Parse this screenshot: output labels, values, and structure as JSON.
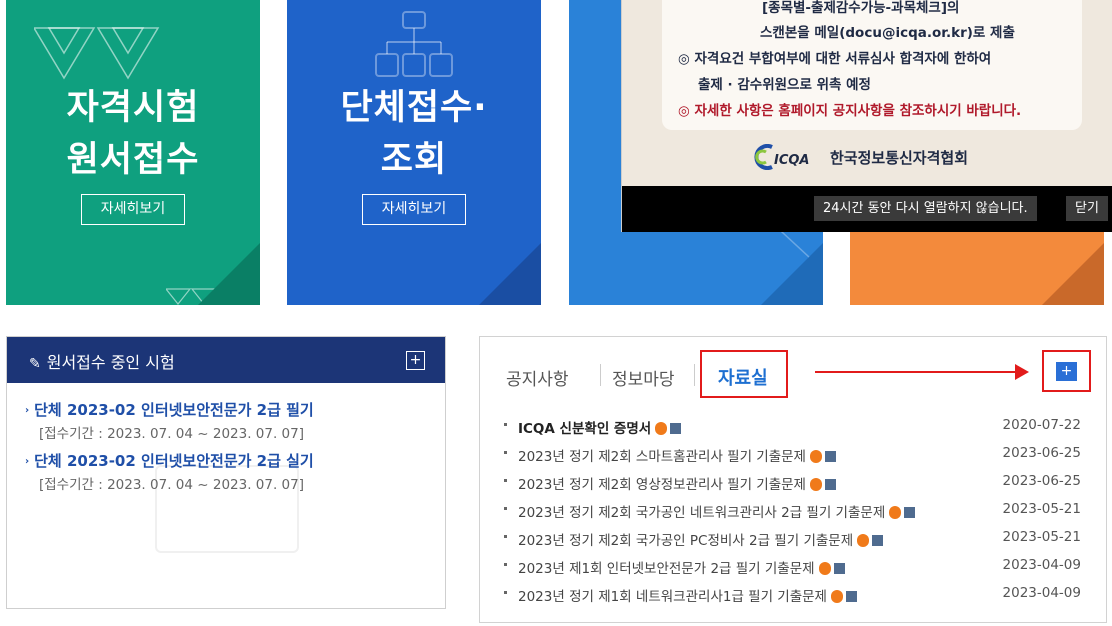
{
  "tiles": {
    "apply": {
      "line1": "자격시험",
      "line2": "원서접수",
      "button": "자세히보기"
    },
    "group": {
      "line1": "단체접수·",
      "line2": "조회",
      "button": "자세히보기"
    }
  },
  "popup": {
    "line1": "[종목별-출제감수가능-과목체크]의",
    "line2": "스캔본을 메일(docu@icqa.or.kr)로 제출",
    "line3": "◎ 자격요건 부합여부에 대한 서류심사 합격자에 한하여",
    "line4": "출제 · 감수위원으로 위촉 예정",
    "line5": "◎ 자세한 사항은 홈페이지 공지사항을 참조하시기 바랍니다.",
    "logo_mark": "ICQA",
    "logo_text": "한국정보통신자격협회",
    "hide_label": "24시간 동안 다시 열람하지 않습니다.",
    "close_label": "닫기"
  },
  "exam_panel": {
    "title": "원서접수 중인 시험",
    "plus": "+",
    "items": [
      {
        "title": "단체 2023-02 인터넷보안전문가 2급 필기",
        "period": "[접수기간 : 2023. 07. 04 ~ 2023. 07. 07]"
      },
      {
        "title": "단체 2023-02 인터넷보안전문가 2급 실기",
        "period": "[접수기간 : 2023. 07. 04 ~ 2023. 07. 07]"
      }
    ]
  },
  "board": {
    "tabs": [
      "공지사항",
      "정보마당",
      "자료실"
    ],
    "more": "+",
    "posts": [
      {
        "title": "ICQA 신분확인 증명서",
        "date": "2020-07-22"
      },
      {
        "title": "2023년 정기 제2회 스마트홈관리사 필기 기출문제",
        "date": "2023-06-25"
      },
      {
        "title": "2023년 정기 제2회 영상정보관리사 필기 기출문제",
        "date": "2023-06-25"
      },
      {
        "title": "2023년 정기 제2회 국가공인 네트워크관리사 2급 필기 기출문제",
        "date": "2023-05-21"
      },
      {
        "title": "2023년 정기 제2회 국가공인 PC정비사 2급 필기 기출문제",
        "date": "2023-05-21"
      },
      {
        "title": "2023년 제1회 인터넷보안전문가 2급 필기 기출문제",
        "date": "2023-04-09"
      },
      {
        "title": "2023년 정기 제1회 네트워크관리사1급 필기 기출문제",
        "date": "2023-04-09"
      }
    ]
  },
  "colors": {
    "green": "#0fa07f",
    "blue": "#1f63c9",
    "sky": "#2a82d8",
    "orange": "#f38a3c",
    "navy": "#1c3577",
    "highlight_red": "#e21b1b",
    "link_blue": "#1f4fa8"
  }
}
